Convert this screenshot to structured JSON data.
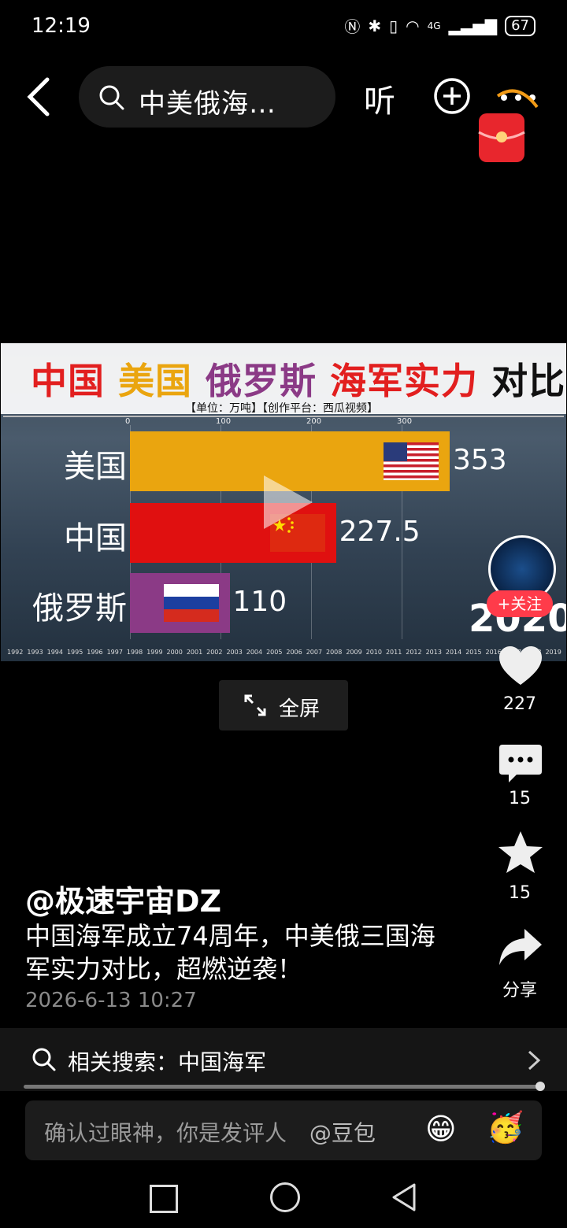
{
  "status": {
    "time": "12:19",
    "battery": "67",
    "network": "4G"
  },
  "topbar": {
    "search_text": "中美俄海…",
    "listen_label": "听"
  },
  "video": {
    "title_parts": [
      {
        "text": "中国",
        "color": "#e21f1f"
      },
      {
        "text": "美国",
        "color": "#eaa50f"
      },
      {
        "text": "俄罗斯",
        "color": "#8b3a86"
      },
      {
        "text": "海军实力",
        "color": "#e21f1f"
      },
      {
        "text": "对比",
        "color": "#111111"
      }
    ],
    "subtitle": "【单位：万吨】【创作平台：西瓜视频】",
    "year": "2020",
    "timeline": [
      "1992",
      "1993",
      "1994",
      "1995",
      "1996",
      "1997",
      "1998",
      "1999",
      "2000",
      "2001",
      "2002",
      "2003",
      "2004",
      "2005",
      "2006",
      "2007",
      "2008",
      "2009",
      "2010",
      "2011",
      "2012",
      "2013",
      "2014",
      "2015",
      "2016",
      "2017",
      "2018",
      "2019"
    ]
  },
  "chart_data": {
    "type": "bar",
    "orientation": "horizontal",
    "categories": [
      "美国",
      "中国",
      "俄罗斯"
    ],
    "values": [
      353,
      227.5,
      110
    ],
    "value_labels": [
      "353",
      "227.5",
      "110"
    ],
    "colors": [
      "#eaa50f",
      "#e01010",
      "#8b3a86"
    ],
    "ticks": [
      0,
      100,
      200,
      300
    ],
    "xlim": [
      0,
      360
    ]
  },
  "actions": {
    "follow_label": "+关注",
    "fullscreen_label": "全屏",
    "likes": "227",
    "comments": "15",
    "favorites": "15",
    "share_label": "分享"
  },
  "post": {
    "author": "@极速宇宙DZ",
    "description": "中国海军成立74周年，中美俄三国海军实力对比，超燃逆袭！",
    "date": "2026-6-13 10:27"
  },
  "related": {
    "label": "相关搜索：中国海军"
  },
  "comment": {
    "placeholder": "确认过眼神，你是发评人",
    "mention": "@豆包",
    "emoji1": "😁",
    "emoji2": "🥳"
  }
}
